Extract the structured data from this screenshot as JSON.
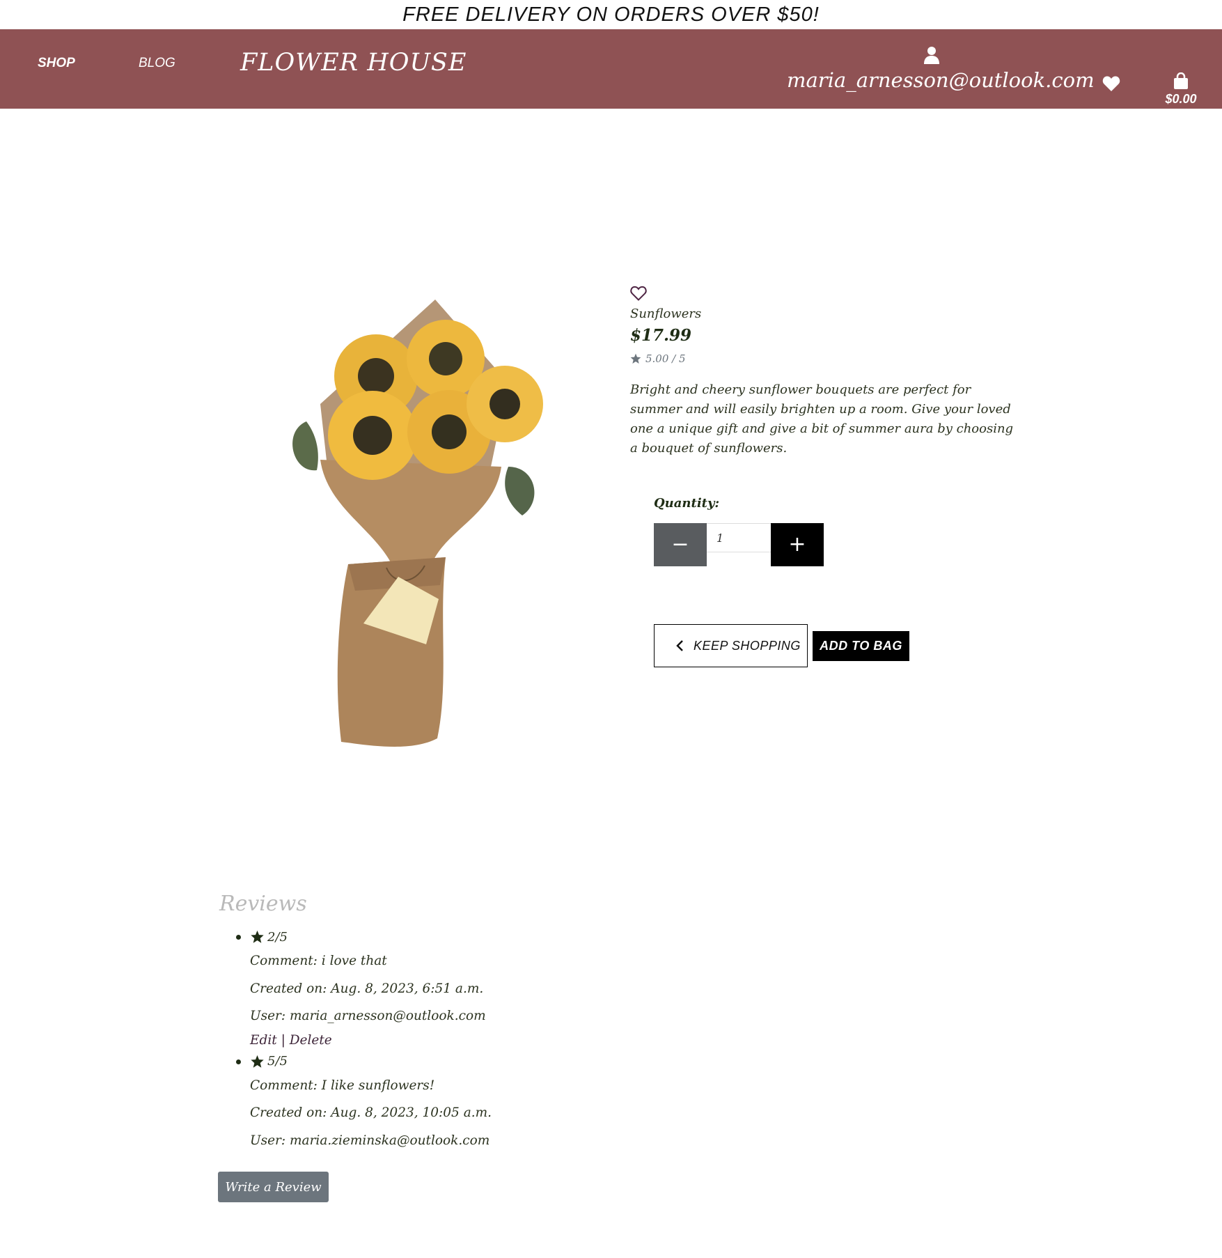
{
  "banner": {
    "text": "FREE DELIVERY ON ORDERS OVER $50!"
  },
  "nav": {
    "shop_label": "SHOP",
    "blog_label": "BLOG",
    "brand": "FLOWER HOUSE",
    "account_email": "maria_arnesson@outlook.com",
    "bag_total": "$0.00",
    "icons": {
      "account": "user-icon",
      "wishlist": "heart-icon",
      "bag": "shopping-bag-icon"
    }
  },
  "product": {
    "name": "Sunflowers",
    "price": "$17.99",
    "rating": "5.00 / 5",
    "description": "Bright and cheery sunflower bouquets are perfect for summer and will easily brighten up a room. Give your loved one a unique gift and give a bit of summer aura by choosing a bouquet of sunflowers.",
    "image_subject": "sunflower-bouquet-illustration"
  },
  "quantity": {
    "label": "Quantity:",
    "value": "1",
    "minus_label": "−",
    "plus_label": "+"
  },
  "actions": {
    "keep_shopping": "KEEP SHOPPING",
    "add_to_bag": "ADD TO BAG"
  },
  "reviews": {
    "title": "Reviews",
    "items": [
      {
        "rating": "2/5",
        "comment": "Comment: i love that",
        "created": "Created on: Aug. 8, 2023, 6:51 a.m.",
        "user": "User: maria_arnesson@outlook.com",
        "edit": "Edit",
        "separator": "|",
        "delete": "Delete"
      },
      {
        "rating": "5/5",
        "comment": "Comment: I like sunflowers!",
        "created": "Created on: Aug. 8, 2023, 10:05 a.m.",
        "user": "User: maria.zieminska@outlook.com"
      }
    ],
    "write_button": "Write a Review"
  },
  "colors": {
    "navbar": "#8f5254",
    "text_dark_green": "#1f2d15",
    "muted_gray": "#6c757d",
    "link_plum": "#3d2438"
  }
}
